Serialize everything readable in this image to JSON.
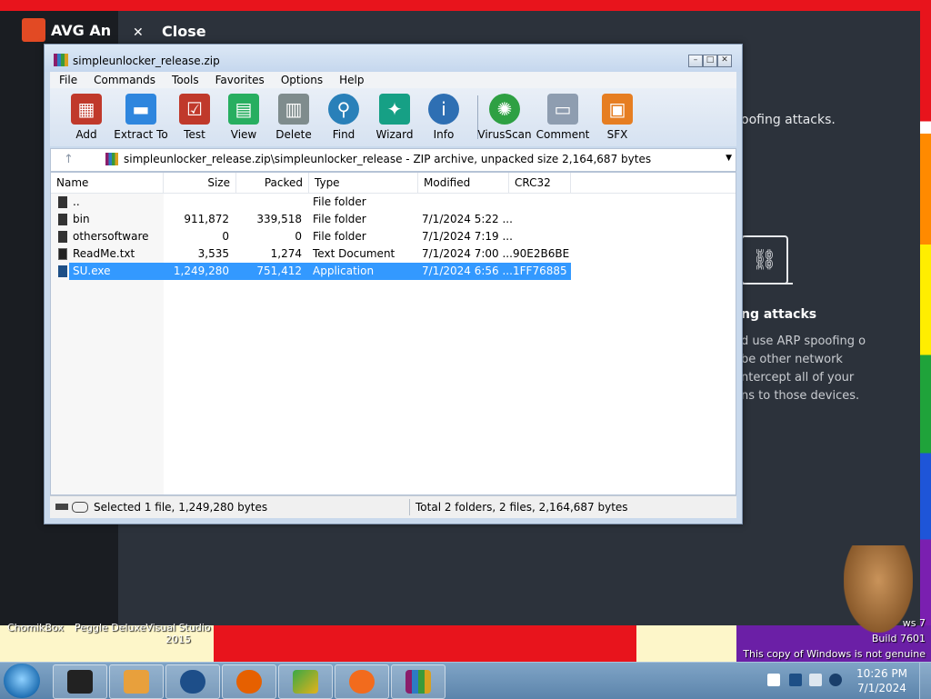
{
  "avg": {
    "logo": "AVG An",
    "close_label": "Close",
    "para1": "oofing attacks.",
    "heading": "ng attacks",
    "body": "d use ARP spoofing o be other network ntercept all of your ns to those devices."
  },
  "window": {
    "title": "simpleunlocker_release.zip",
    "menu": [
      "File",
      "Commands",
      "Tools",
      "Favorites",
      "Options",
      "Help"
    ],
    "toolbar": [
      {
        "label": "Add",
        "icon": "add-archive-icon",
        "color": "#c0392b"
      },
      {
        "label": "Extract To",
        "icon": "extract-folder-icon",
        "color": "#2e86de"
      },
      {
        "label": "Test",
        "icon": "test-clipboard-icon",
        "color": "#c0392b"
      },
      {
        "label": "View",
        "icon": "view-book-icon",
        "color": "#27ae60"
      },
      {
        "label": "Delete",
        "icon": "delete-bin-icon",
        "color": "#7f8c8d"
      },
      {
        "label": "Find",
        "icon": "find-magnifier-icon",
        "color": "#2980b9"
      },
      {
        "label": "Wizard",
        "icon": "wizard-wand-icon",
        "color": "#16a085"
      },
      {
        "label": "Info",
        "icon": "info-icon",
        "color": "#2e6fb3"
      },
      {
        "label": "VirusScan",
        "icon": "virus-scan-icon",
        "color": "#2ea043"
      },
      {
        "label": "Comment",
        "icon": "comment-icon",
        "color": "#8e9db0"
      },
      {
        "label": "SFX",
        "icon": "sfx-box-icon",
        "color": "#e67e22"
      }
    ],
    "address": "simpleunlocker_release.zip\\simpleunlocker_release - ZIP archive, unpacked size 2,164,687 bytes",
    "columns": [
      "Name",
      "Size",
      "Packed",
      "Type",
      "Modified",
      "CRC32"
    ],
    "rows": [
      {
        "name": "..",
        "size": "",
        "packed": "",
        "type": "File folder",
        "modified": "",
        "crc": ""
      },
      {
        "name": "bin",
        "size": "911,872",
        "packed": "339,518",
        "type": "File folder",
        "modified": "7/1/2024 5:22 ...",
        "crc": ""
      },
      {
        "name": "othersoftware",
        "size": "0",
        "packed": "0",
        "type": "File folder",
        "modified": "7/1/2024 7:19 ...",
        "crc": ""
      },
      {
        "name": "ReadMe.txt",
        "size": "3,535",
        "packed": "1,274",
        "type": "Text Document",
        "modified": "7/1/2024 7:00 ...",
        "crc": "90E2B6BE"
      },
      {
        "name": "SU.exe",
        "size": "1,249,280",
        "packed": "751,412",
        "type": "Application",
        "modified": "7/1/2024 6:56 ...",
        "crc": "1FF76885"
      }
    ],
    "status_left": "Selected 1 file, 1,249,280 bytes",
    "status_right": "Total 2 folders, 2 files, 2,164,687 bytes"
  },
  "desktop": {
    "icons": [
      "ChomikBox",
      "Peggle Deluxe",
      "Visual Studio 2015"
    ],
    "win_line1": "ws 7",
    "win_line2": "Build 7601",
    "win_line3": "This copy of Windows is not genuine"
  },
  "taskbar": {
    "time": "10:26 PM",
    "date": "7/1/2024"
  }
}
